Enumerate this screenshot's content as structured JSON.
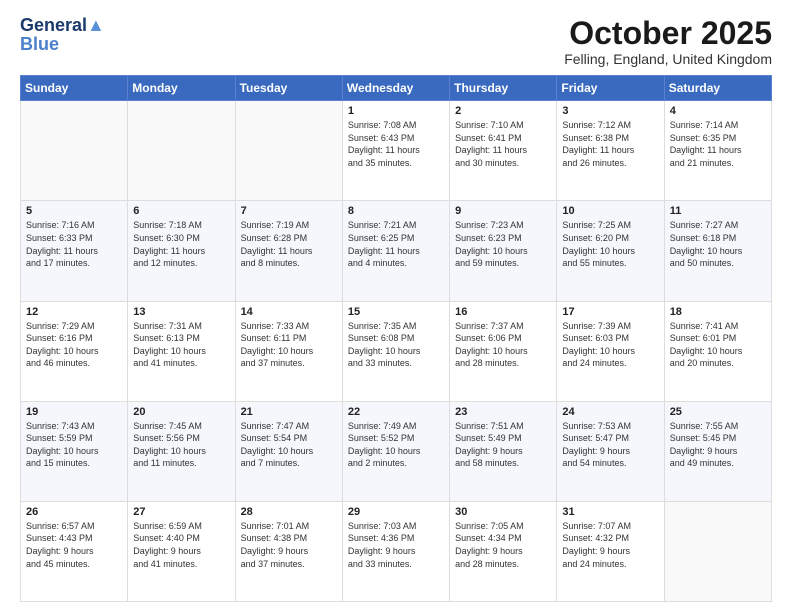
{
  "header": {
    "logo_line1": "General",
    "logo_line2": "Blue",
    "month": "October 2025",
    "location": "Felling, England, United Kingdom"
  },
  "weekdays": [
    "Sunday",
    "Monday",
    "Tuesday",
    "Wednesday",
    "Thursday",
    "Friday",
    "Saturday"
  ],
  "weeks": [
    [
      {
        "day": "",
        "info": ""
      },
      {
        "day": "",
        "info": ""
      },
      {
        "day": "",
        "info": ""
      },
      {
        "day": "1",
        "info": "Sunrise: 7:08 AM\nSunset: 6:43 PM\nDaylight: 11 hours\nand 35 minutes."
      },
      {
        "day": "2",
        "info": "Sunrise: 7:10 AM\nSunset: 6:41 PM\nDaylight: 11 hours\nand 30 minutes."
      },
      {
        "day": "3",
        "info": "Sunrise: 7:12 AM\nSunset: 6:38 PM\nDaylight: 11 hours\nand 26 minutes."
      },
      {
        "day": "4",
        "info": "Sunrise: 7:14 AM\nSunset: 6:35 PM\nDaylight: 11 hours\nand 21 minutes."
      }
    ],
    [
      {
        "day": "5",
        "info": "Sunrise: 7:16 AM\nSunset: 6:33 PM\nDaylight: 11 hours\nand 17 minutes."
      },
      {
        "day": "6",
        "info": "Sunrise: 7:18 AM\nSunset: 6:30 PM\nDaylight: 11 hours\nand 12 minutes."
      },
      {
        "day": "7",
        "info": "Sunrise: 7:19 AM\nSunset: 6:28 PM\nDaylight: 11 hours\nand 8 minutes."
      },
      {
        "day": "8",
        "info": "Sunrise: 7:21 AM\nSunset: 6:25 PM\nDaylight: 11 hours\nand 4 minutes."
      },
      {
        "day": "9",
        "info": "Sunrise: 7:23 AM\nSunset: 6:23 PM\nDaylight: 10 hours\nand 59 minutes."
      },
      {
        "day": "10",
        "info": "Sunrise: 7:25 AM\nSunset: 6:20 PM\nDaylight: 10 hours\nand 55 minutes."
      },
      {
        "day": "11",
        "info": "Sunrise: 7:27 AM\nSunset: 6:18 PM\nDaylight: 10 hours\nand 50 minutes."
      }
    ],
    [
      {
        "day": "12",
        "info": "Sunrise: 7:29 AM\nSunset: 6:16 PM\nDaylight: 10 hours\nand 46 minutes."
      },
      {
        "day": "13",
        "info": "Sunrise: 7:31 AM\nSunset: 6:13 PM\nDaylight: 10 hours\nand 41 minutes."
      },
      {
        "day": "14",
        "info": "Sunrise: 7:33 AM\nSunset: 6:11 PM\nDaylight: 10 hours\nand 37 minutes."
      },
      {
        "day": "15",
        "info": "Sunrise: 7:35 AM\nSunset: 6:08 PM\nDaylight: 10 hours\nand 33 minutes."
      },
      {
        "day": "16",
        "info": "Sunrise: 7:37 AM\nSunset: 6:06 PM\nDaylight: 10 hours\nand 28 minutes."
      },
      {
        "day": "17",
        "info": "Sunrise: 7:39 AM\nSunset: 6:03 PM\nDaylight: 10 hours\nand 24 minutes."
      },
      {
        "day": "18",
        "info": "Sunrise: 7:41 AM\nSunset: 6:01 PM\nDaylight: 10 hours\nand 20 minutes."
      }
    ],
    [
      {
        "day": "19",
        "info": "Sunrise: 7:43 AM\nSunset: 5:59 PM\nDaylight: 10 hours\nand 15 minutes."
      },
      {
        "day": "20",
        "info": "Sunrise: 7:45 AM\nSunset: 5:56 PM\nDaylight: 10 hours\nand 11 minutes."
      },
      {
        "day": "21",
        "info": "Sunrise: 7:47 AM\nSunset: 5:54 PM\nDaylight: 10 hours\nand 7 minutes."
      },
      {
        "day": "22",
        "info": "Sunrise: 7:49 AM\nSunset: 5:52 PM\nDaylight: 10 hours\nand 2 minutes."
      },
      {
        "day": "23",
        "info": "Sunrise: 7:51 AM\nSunset: 5:49 PM\nDaylight: 9 hours\nand 58 minutes."
      },
      {
        "day": "24",
        "info": "Sunrise: 7:53 AM\nSunset: 5:47 PM\nDaylight: 9 hours\nand 54 minutes."
      },
      {
        "day": "25",
        "info": "Sunrise: 7:55 AM\nSunset: 5:45 PM\nDaylight: 9 hours\nand 49 minutes."
      }
    ],
    [
      {
        "day": "26",
        "info": "Sunrise: 6:57 AM\nSunset: 4:43 PM\nDaylight: 9 hours\nand 45 minutes."
      },
      {
        "day": "27",
        "info": "Sunrise: 6:59 AM\nSunset: 4:40 PM\nDaylight: 9 hours\nand 41 minutes."
      },
      {
        "day": "28",
        "info": "Sunrise: 7:01 AM\nSunset: 4:38 PM\nDaylight: 9 hours\nand 37 minutes."
      },
      {
        "day": "29",
        "info": "Sunrise: 7:03 AM\nSunset: 4:36 PM\nDaylight: 9 hours\nand 33 minutes."
      },
      {
        "day": "30",
        "info": "Sunrise: 7:05 AM\nSunset: 4:34 PM\nDaylight: 9 hours\nand 28 minutes."
      },
      {
        "day": "31",
        "info": "Sunrise: 7:07 AM\nSunset: 4:32 PM\nDaylight: 9 hours\nand 24 minutes."
      },
      {
        "day": "",
        "info": ""
      }
    ]
  ]
}
